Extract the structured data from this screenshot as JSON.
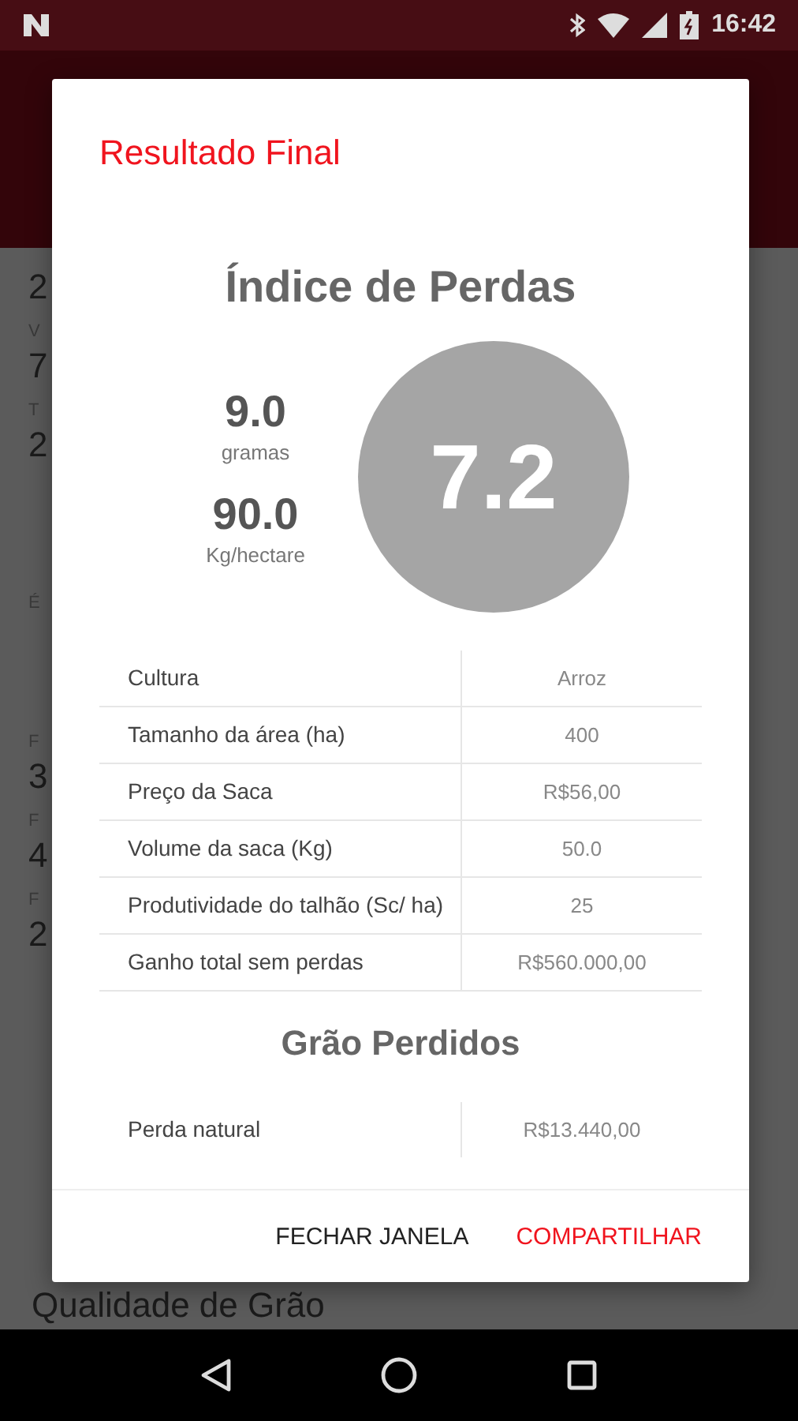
{
  "status_bar": {
    "time": "16:42"
  },
  "background": {
    "items": [
      {
        "kind": "value",
        "text": "2"
      },
      {
        "kind": "label",
        "text": "V"
      },
      {
        "kind": "value",
        "text": "7"
      },
      {
        "kind": "label",
        "text": "T"
      },
      {
        "kind": "value",
        "text": "2"
      },
      {
        "kind": "gap"
      },
      {
        "kind": "gap"
      },
      {
        "kind": "label",
        "text": "É"
      },
      {
        "kind": "gap"
      },
      {
        "kind": "gap"
      },
      {
        "kind": "label",
        "text": "F"
      },
      {
        "kind": "value",
        "text": "3"
      },
      {
        "kind": "label",
        "text": "F"
      },
      {
        "kind": "value",
        "text": "4"
      },
      {
        "kind": "label",
        "text": "F"
      },
      {
        "kind": "value",
        "text": "2"
      }
    ],
    "bottom_heading": "Qualidade de Grão"
  },
  "dialog": {
    "title": "Resultado Final",
    "heading": "Índice de Perdas",
    "stats": [
      {
        "value": "9.0",
        "unit": "gramas"
      },
      {
        "value": "90.0",
        "unit": "Kg/hectare"
      }
    ],
    "index": "7.2",
    "table": [
      {
        "label": "Cultura",
        "value": "Arroz"
      },
      {
        "label": "Tamanho da área (ha)",
        "value": "400"
      },
      {
        "label": "Preço da Saca",
        "value": "R$56,00"
      },
      {
        "label": "Volume da saca (Kg)",
        "value": "50.0"
      },
      {
        "label": "Produtividade do talhão (Sc/ ha)",
        "value": "25"
      },
      {
        "label": "Ganho total sem perdas",
        "value": "R$560.000,00"
      }
    ],
    "section": "Grão Perdidos",
    "lost_table": [
      {
        "label": "Perda natural",
        "value": "R$13.440,00"
      }
    ],
    "buttons": [
      {
        "label": "FECHAR JANELA",
        "kind": "neutral"
      },
      {
        "label": "COMPARTILHAR",
        "kind": "primary"
      }
    ]
  }
}
